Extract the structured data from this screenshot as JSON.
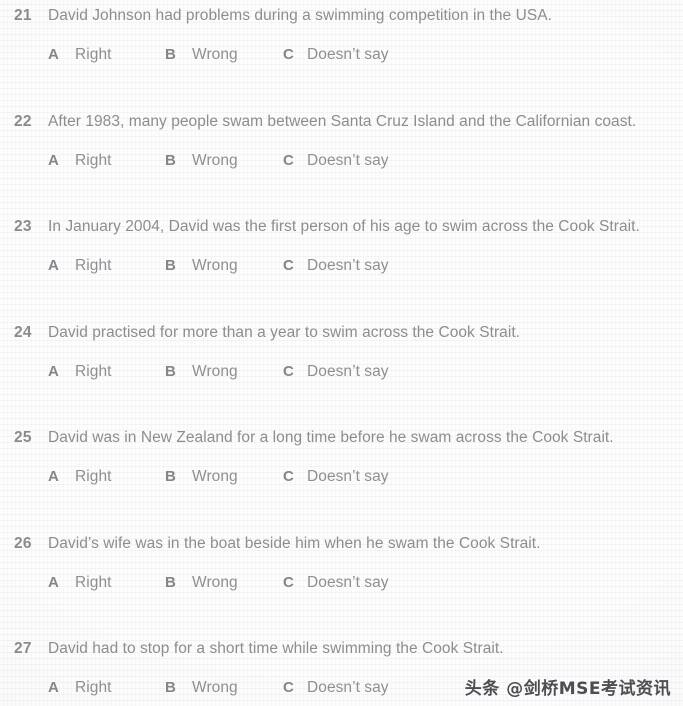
{
  "page": {
    "background_color": "#fdfdfd",
    "text_color": "#8d8d90",
    "watermark_color": "#3f3f44"
  },
  "watermark": {
    "text": "头条 @剑桥MSE考试资讯"
  },
  "option_labels": {
    "a_letter": "A",
    "a_text": "Right",
    "b_letter": "B",
    "b_text": "Wrong",
    "c_letter": "C",
    "c_text": "Doesn’t say"
  },
  "questions": [
    {
      "number": "21",
      "text": "David Johnson had problems during a swimming competition in the USA.",
      "options": [
        {
          "letter": "A",
          "label": "Right"
        },
        {
          "letter": "B",
          "label": "Wrong"
        },
        {
          "letter": "C",
          "label": "Doesn’t say"
        }
      ]
    },
    {
      "number": "22",
      "text": "After 1983, many people swam between Santa Cruz Island and the Californian coast.",
      "options": [
        {
          "letter": "A",
          "label": "Right"
        },
        {
          "letter": "B",
          "label": "Wrong"
        },
        {
          "letter": "C",
          "label": "Doesn’t say"
        }
      ]
    },
    {
      "number": "23",
      "text": "In January 2004, David was the first person of his age to swim across the Cook Strait.",
      "options": [
        {
          "letter": "A",
          "label": "Right"
        },
        {
          "letter": "B",
          "label": "Wrong"
        },
        {
          "letter": "C",
          "label": "Doesn’t say"
        }
      ]
    },
    {
      "number": "24",
      "text": "David practised for more than a year to swim across the Cook Strait.",
      "options": [
        {
          "letter": "A",
          "label": "Right"
        },
        {
          "letter": "B",
          "label": "Wrong"
        },
        {
          "letter": "C",
          "label": "Doesn’t say"
        }
      ]
    },
    {
      "number": "25",
      "text": "David was in New Zealand for a long time before he swam across the Cook Strait.",
      "options": [
        {
          "letter": "A",
          "label": "Right"
        },
        {
          "letter": "B",
          "label": "Wrong"
        },
        {
          "letter": "C",
          "label": "Doesn’t say"
        }
      ]
    },
    {
      "number": "26",
      "text": "David’s wife was in the boat beside him when he swam the Cook Strait.",
      "options": [
        {
          "letter": "A",
          "label": "Right"
        },
        {
          "letter": "B",
          "label": "Wrong"
        },
        {
          "letter": "C",
          "label": "Doesn’t say"
        }
      ]
    },
    {
      "number": "27",
      "text": "David had to stop for a short time while swimming the Cook Strait.",
      "options": [
        {
          "letter": "A",
          "label": "Right"
        },
        {
          "letter": "B",
          "label": "Wrong"
        },
        {
          "letter": "C",
          "label": "Doesn’t say"
        }
      ]
    }
  ]
}
